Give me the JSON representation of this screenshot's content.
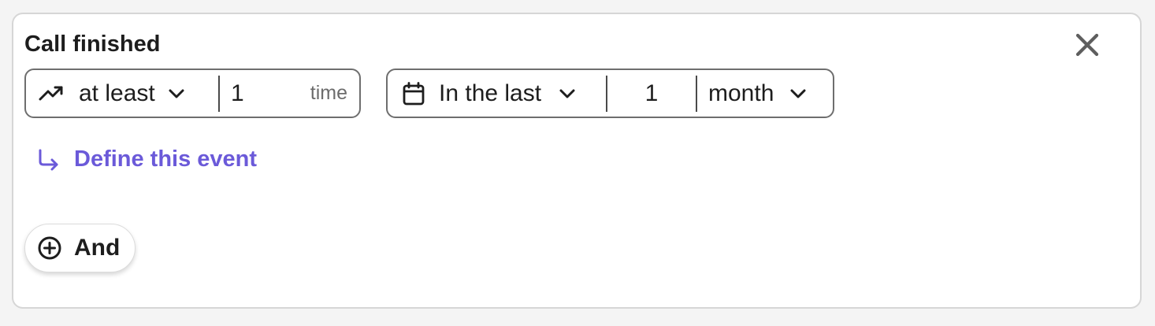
{
  "condition": {
    "title": "Call finished",
    "frequency": {
      "operator_label": "at least",
      "count_value": "1",
      "unit_suffix": "time"
    },
    "time_window": {
      "range_label": "In the last",
      "amount_value": "1",
      "unit_label": "month"
    },
    "define_link_label": "Define this event"
  },
  "actions": {
    "and_button_label": "And"
  },
  "icons": {
    "close": "close-icon",
    "trend": "trending-up-icon",
    "calendar": "calendar-icon",
    "chevron": "chevron-down-icon",
    "arrow": "arrow-down-right-icon",
    "add": "plus-circle-icon"
  },
  "colors": {
    "accent": "#6b5ad9",
    "border": "#6e6e6e",
    "text": "#1d1d1d"
  }
}
